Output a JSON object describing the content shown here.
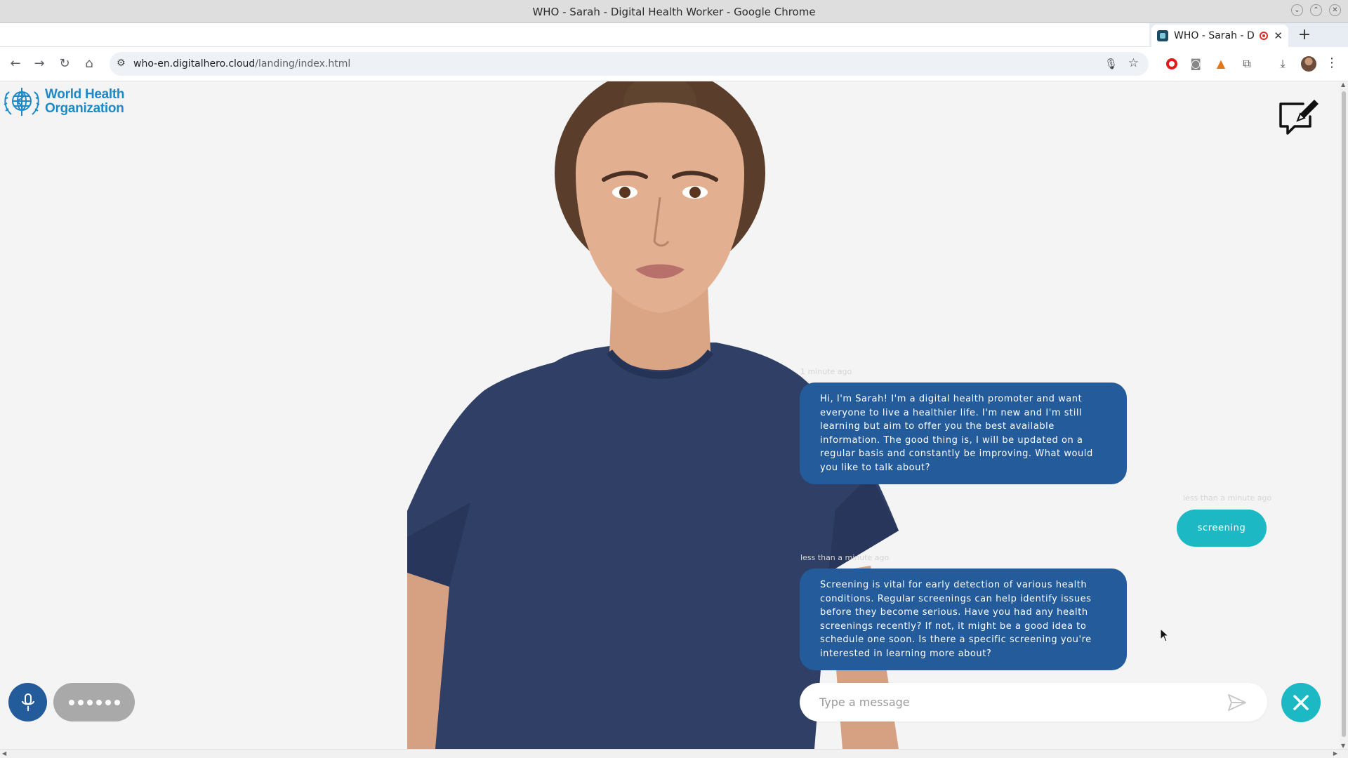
{
  "window": {
    "title": "WHO - Sarah - Digital Health Worker - Google Chrome",
    "controls": [
      "minimize",
      "maximize",
      "close"
    ]
  },
  "browser": {
    "tab_title": "WHO - Sarah - Di",
    "url_host": "who-en.digitalhero.cloud",
    "url_path": "/landing/index.html",
    "new_tab": "+"
  },
  "page": {
    "logo": {
      "line1": "World Health",
      "line2": "Organization",
      "brand_color": "#1d8ac8"
    },
    "chat": {
      "messages": [
        {
          "role": "bot",
          "timestamp": "1 minute ago",
          "text": "Hi, I'm Sarah! I'm a digital health promoter and want everyone to live a healthier life. I'm new and I'm still learning but aim to offer you the best available information. The good thing is, I will be updated on a regular basis and constantly be improving. What would you like to talk about?"
        },
        {
          "role": "user",
          "timestamp": "less than a minute ago",
          "text": "screening"
        },
        {
          "role": "bot",
          "timestamp": "less than a minute ago",
          "text": "Screening is vital for early detection of various health conditions. Regular screenings can help identify issues before they become serious. Have you had any health screenings recently? If not, it might be a good idea to schedule one soon. Is there a specific screening you're interested in learning more about?"
        }
      ],
      "input_placeholder": "Type a message",
      "bot_bubble_color": "#235b9b",
      "user_bubble_color": "#1cb8c4"
    },
    "controls": {
      "mic_icon": "microphone-icon",
      "typing_indicator_dots": 6,
      "close_icon": "close-icon",
      "send_icon": "send-icon",
      "feedback_icon": "feedback-edit-icon"
    }
  }
}
